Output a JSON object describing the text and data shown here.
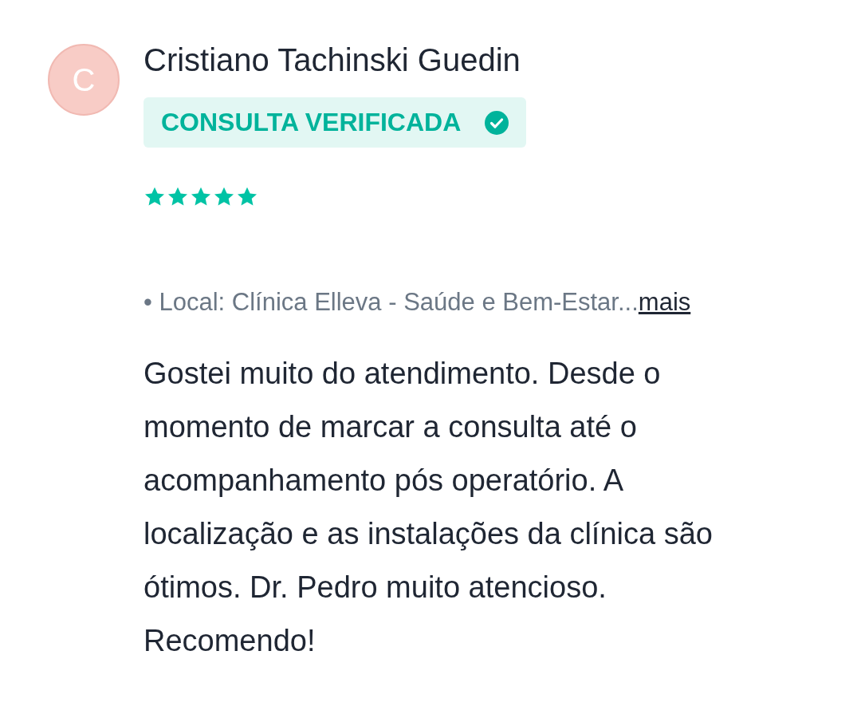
{
  "review": {
    "avatar_letter": "C",
    "author": "Cristiano Tachinski Guedin",
    "badge": {
      "label": "CONSULTA VERIFICADA",
      "verified": true
    },
    "stars": 5,
    "location": "• Local: Clínica Elleva - Saúde e Bem-Estar...",
    "more_link": "mais",
    "text": "Gostei muito do atendimento. Desde o momento de marcar a consulta até o acompanhamento pós operatório. A localização e as instalações da clínica são ótimos. Dr. Pedro muito atencioso. Recomendo!"
  }
}
